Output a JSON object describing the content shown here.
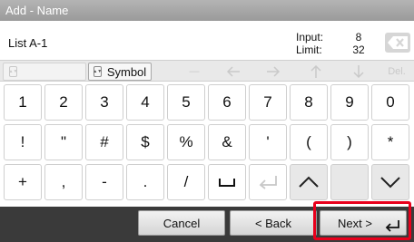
{
  "title": "Add - Name",
  "input": {
    "value": "List A-1",
    "input_label": "Input:",
    "input_value": "8",
    "limit_label": "Limit:",
    "limit_value": "32",
    "delete_icon": "backspace-icon"
  },
  "options": {
    "symbol_label": "Symbol",
    "del_label": "Del."
  },
  "keys": {
    "row1": [
      "1",
      "2",
      "3",
      "4",
      "5",
      "6",
      "7",
      "8",
      "9",
      "0"
    ],
    "row2": [
      "!",
      "\"",
      "#",
      "$",
      "%",
      "&",
      "'",
      "(",
      ")",
      "*"
    ],
    "row3": [
      "+",
      ",",
      "-",
      ".",
      "/"
    ]
  },
  "footer": {
    "cancel_label": "Cancel",
    "back_label": "< Back",
    "next_label": "Next >"
  },
  "colors": {
    "title_bar": "#a7a7a7",
    "footer": "#3a3a3a",
    "highlight": "#e8001c"
  }
}
